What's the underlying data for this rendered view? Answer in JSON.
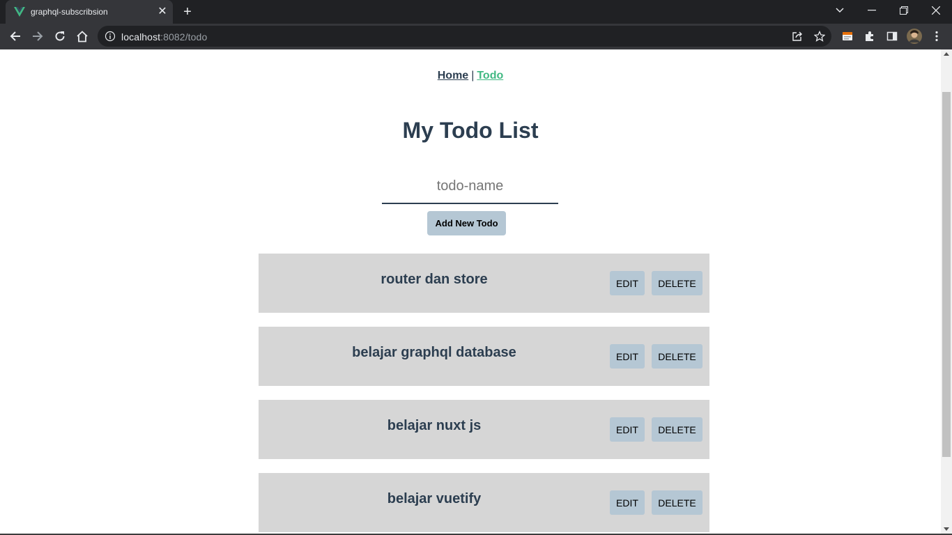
{
  "browser": {
    "tab_title": "graphql-subscribsion",
    "url_host": "localhost",
    "url_rest": ":8082/todo"
  },
  "nav": {
    "home": "Home",
    "separator": "|",
    "todo": "Todo"
  },
  "page": {
    "title": "My Todo List",
    "input_placeholder": "todo-name",
    "add_button": "Add New Todo"
  },
  "todos": [
    {
      "name": "router dan store",
      "edit": "EDIT",
      "delete": "DELETE"
    },
    {
      "name": "belajar graphql database",
      "edit": "EDIT",
      "delete": "DELETE"
    },
    {
      "name": "belajar nuxt js",
      "edit": "EDIT",
      "delete": "DELETE"
    },
    {
      "name": "belajar vuetify",
      "edit": "EDIT",
      "delete": "DELETE"
    }
  ],
  "colors": {
    "text": "#2c3e50",
    "active_link": "#42b983",
    "button": "#b5c7d4",
    "card": "#d6d6d6"
  }
}
